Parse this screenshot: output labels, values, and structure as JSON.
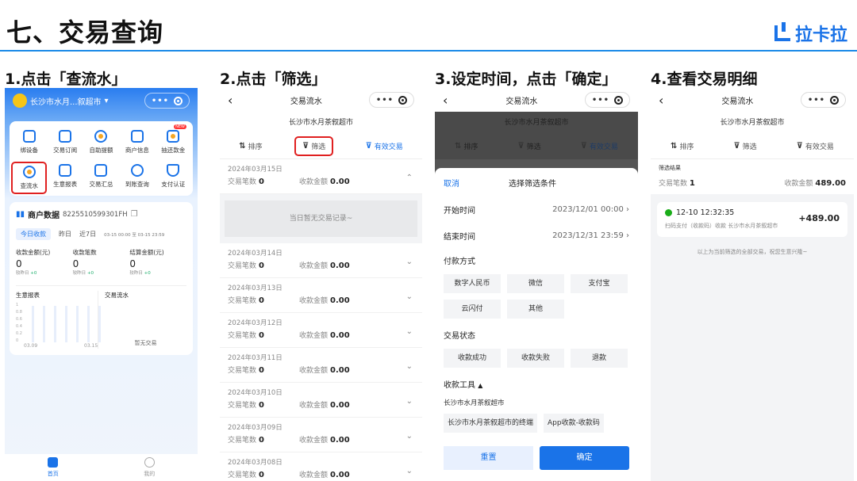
{
  "slide": {
    "title": "七、交易查询",
    "brand": "拉卡拉",
    "steps": [
      "1.点击「查流水」",
      "2.点击「筛选」",
      "3.设定时间，点击「确定」",
      "4.查看交易明细"
    ]
  },
  "phone1": {
    "location": "长沙市水月...叙超市",
    "grid": [
      "绑设备",
      "交易订阅",
      "自助提额",
      "商户信息",
      "抽还款金",
      "查流水",
      "生意报表",
      "交易汇总",
      "到账查询",
      "支付认证"
    ],
    "new_badge": "NEW",
    "card_title": "商户数据",
    "merchant_id": "8225510599301FH",
    "tabs": [
      "今日收款",
      "昨日",
      "近7日"
    ],
    "range": "03-15 00:00 至 03-15 23:59",
    "stats": [
      {
        "label": "收款金额(元)",
        "value": "0",
        "compare": "较昨日",
        "delta": "+0"
      },
      {
        "label": "收款笔数",
        "value": "0",
        "compare": "较昨日",
        "delta": "+0"
      },
      {
        "label": "结算金额(元)",
        "value": "0",
        "compare": "较昨日",
        "delta": "+0"
      }
    ],
    "report_title": "生意报表",
    "axis": [
      "1",
      "0.8",
      "0.6",
      "0.4",
      "0.2",
      "0"
    ],
    "x_start": "03.09",
    "x_end": "03.15",
    "flow_title": "交易流水",
    "no_tx": "暂无交易",
    "nav": [
      "首页",
      "我的"
    ]
  },
  "common": {
    "page_title": "交易流水",
    "merchant": "长沙市水月茶叙超市",
    "tabs": [
      "排序",
      "筛选",
      "有效交易"
    ],
    "count_label": "交易笔数",
    "amount_label": "收款金额"
  },
  "phone2": {
    "empty": "当日暂无交易记录~",
    "days": [
      {
        "date": "2024年03月15日",
        "count": "0",
        "amount": "0.00"
      },
      {
        "date": "2024年03月14日",
        "count": "0",
        "amount": "0.00"
      },
      {
        "date": "2024年03月13日",
        "count": "0",
        "amount": "0.00"
      },
      {
        "date": "2024年03月12日",
        "count": "0",
        "amount": "0.00"
      },
      {
        "date": "2024年03月11日",
        "count": "0",
        "amount": "0.00"
      },
      {
        "date": "2024年03月10日",
        "count": "0",
        "amount": "0.00"
      },
      {
        "date": "2024年03月09日",
        "count": "0",
        "amount": "0.00"
      },
      {
        "date": "2024年03月08日",
        "count": "0",
        "amount": "0.00"
      }
    ]
  },
  "phone3": {
    "cancel": "取消",
    "sheet_title": "选择筛选条件",
    "start_label": "开始时间",
    "start_value": "2023/12/01 00:00",
    "end_label": "结束时间",
    "end_value": "2023/12/31 23:59",
    "pay_label": "付款方式",
    "pay": [
      "数字人民币",
      "微信",
      "支付宝",
      "云闪付",
      "其他"
    ],
    "status_label": "交易状态",
    "status": [
      "收款成功",
      "收款失败",
      "退款"
    ],
    "tool_label": "收款工具",
    "tool_shop": "长沙市水月茶叙超市",
    "tools": [
      "长沙市水月茶叙超市的终端",
      "App收款-收款码"
    ],
    "reset": "重置",
    "confirm": "确定"
  },
  "phone4": {
    "result_label": "筛选结果",
    "count": "1",
    "amount": "489.00",
    "tx_time": "12-10 12:32:35",
    "tx_desc": "扫码支付（收款码）收款 长沙市水月茶叙超市",
    "tx_amount": "+489.00",
    "tip": "以上为当前筛选的全部交易，祝您生意兴隆~"
  },
  "colors": {
    "accent": "#1a73e8",
    "highlight": "#e02020",
    "success": "#1aad19"
  }
}
